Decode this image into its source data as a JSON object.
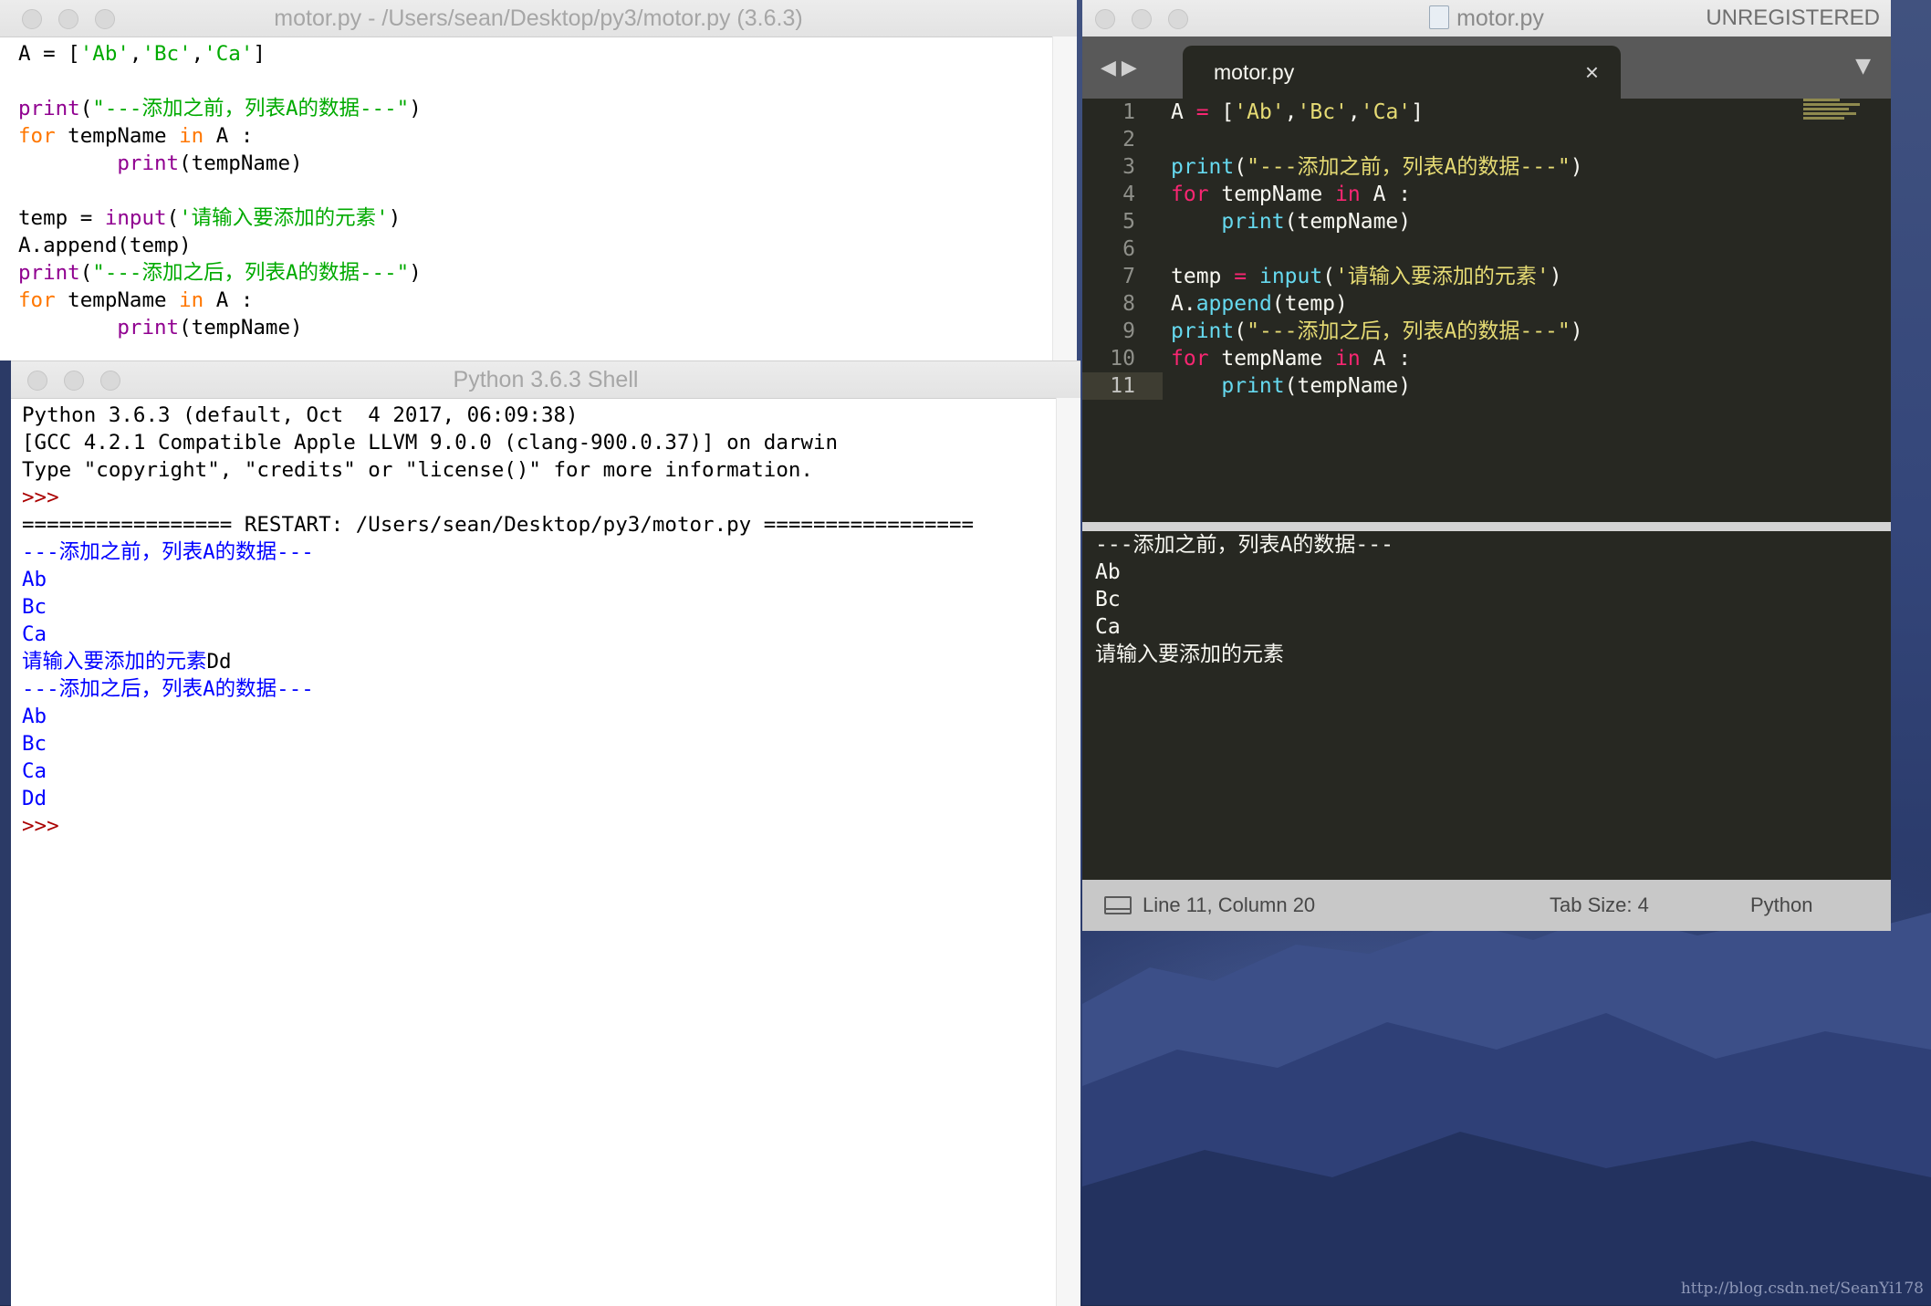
{
  "idle_editor": {
    "title": "motor.py - /Users/sean/Desktop/py3/motor.py (3.6.3)",
    "lines": [
      [
        {
          "t": "A = ['Ab','Bc','Ca']",
          "c": "st-mix"
        }
      ],
      [],
      [
        {
          "t": "print",
          "c": "bi"
        },
        {
          "t": "(",
          "c": ""
        },
        {
          "t": "\"---添加之前，列表A的数据---\"",
          "c": "st"
        },
        {
          "t": ")",
          "c": ""
        }
      ],
      [
        {
          "t": "for",
          "c": "kw"
        },
        {
          "t": " tempName ",
          "c": ""
        },
        {
          "t": "in",
          "c": "kw"
        },
        {
          "t": " A :",
          "c": ""
        }
      ],
      [
        {
          "t": "        ",
          "c": ""
        },
        {
          "t": "print",
          "c": "bi"
        },
        {
          "t": "(tempName)",
          "c": ""
        }
      ],
      [],
      [
        {
          "t": "temp = ",
          "c": ""
        },
        {
          "t": "input",
          "c": "bi"
        },
        {
          "t": "(",
          "c": ""
        },
        {
          "t": "'请输入要添加的元素'",
          "c": "st"
        },
        {
          "t": ")",
          "c": ""
        }
      ],
      [
        {
          "t": "A.append(temp)",
          "c": ""
        }
      ],
      [
        {
          "t": "print",
          "c": "bi"
        },
        {
          "t": "(",
          "c": ""
        },
        {
          "t": "\"---添加之后，列表A的数据---\"",
          "c": "st"
        },
        {
          "t": ")",
          "c": ""
        }
      ],
      [
        {
          "t": "for",
          "c": "kw"
        },
        {
          "t": " tempName ",
          "c": ""
        },
        {
          "t": "in",
          "c": "kw"
        },
        {
          "t": " A :",
          "c": ""
        }
      ],
      [
        {
          "t": "        ",
          "c": ""
        },
        {
          "t": "print",
          "c": "bi"
        },
        {
          "t": "(tempName)",
          "c": ""
        }
      ]
    ]
  },
  "shell": {
    "title": "Python 3.6.3 Shell",
    "lines": [
      [
        {
          "t": "Python 3.6.3 (default, Oct  4 2017, 06:09:38)",
          "c": ""
        }
      ],
      [
        {
          "t": "[GCC 4.2.1 Compatible Apple LLVM 9.0.0 (clang-900.0.37)] on darwin",
          "c": ""
        }
      ],
      [
        {
          "t": "Type \"copyright\", \"credits\" or \"license()\" for more information.",
          "c": ""
        }
      ],
      [
        {
          "t": ">>> ",
          "c": "prompt"
        }
      ],
      [
        {
          "t": "================= RESTART: /Users/sean/Desktop/py3/motor.py =================",
          "c": ""
        }
      ],
      [
        {
          "t": "---添加之前，列表A的数据---",
          "c": "out"
        }
      ],
      [
        {
          "t": "Ab",
          "c": "out"
        }
      ],
      [
        {
          "t": "Bc",
          "c": "out"
        }
      ],
      [
        {
          "t": "Ca",
          "c": "out"
        }
      ],
      [
        {
          "t": "请输入要添加的元素",
          "c": "out"
        },
        {
          "t": "Dd",
          "c": ""
        }
      ],
      [
        {
          "t": "---添加之后，列表A的数据---",
          "c": "out"
        }
      ],
      [
        {
          "t": "Ab",
          "c": "out"
        }
      ],
      [
        {
          "t": "Bc",
          "c": "out"
        }
      ],
      [
        {
          "t": "Ca",
          "c": "out"
        }
      ],
      [
        {
          "t": "Dd",
          "c": "out"
        }
      ],
      [
        {
          "t": ">>> ",
          "c": "prompt"
        }
      ]
    ]
  },
  "sublime": {
    "title": "motor.py",
    "unregistered": "UNREGISTERED",
    "tab_label": "motor.py",
    "tab_close": "×",
    "nav_arrows": "◀▶",
    "dropdown": "▼",
    "line_numbers": [
      "1",
      "2",
      "3",
      "4",
      "5",
      "6",
      "7",
      "8",
      "9",
      "10",
      "11"
    ],
    "active_line": 11,
    "lines": [
      [
        {
          "t": "A ",
          "c": ""
        },
        {
          "t": "=",
          "c": "m-kw"
        },
        {
          "t": " [",
          "c": ""
        },
        {
          "t": "'Ab'",
          "c": "m-str"
        },
        {
          "t": ",",
          "c": ""
        },
        {
          "t": "'Bc'",
          "c": "m-str"
        },
        {
          "t": ",",
          "c": ""
        },
        {
          "t": "'Ca'",
          "c": "m-str"
        },
        {
          "t": "]",
          "c": ""
        }
      ],
      [],
      [
        {
          "t": "print",
          "c": "m-fn"
        },
        {
          "t": "(",
          "c": ""
        },
        {
          "t": "\"---添加之前，列表A的数据---\"",
          "c": "m-str"
        },
        {
          "t": ")",
          "c": ""
        }
      ],
      [
        {
          "t": "for",
          "c": "m-kw"
        },
        {
          "t": " tempName ",
          "c": ""
        },
        {
          "t": "in",
          "c": "m-kw"
        },
        {
          "t": " A :",
          "c": ""
        }
      ],
      [
        {
          "t": "    ",
          "c": ""
        },
        {
          "t": "print",
          "c": "m-fn"
        },
        {
          "t": "(tempName)",
          "c": ""
        }
      ],
      [],
      [
        {
          "t": "temp ",
          "c": ""
        },
        {
          "t": "=",
          "c": "m-kw"
        },
        {
          "t": " ",
          "c": ""
        },
        {
          "t": "input",
          "c": "m-fn"
        },
        {
          "t": "(",
          "c": ""
        },
        {
          "t": "'请输入要添加的元素'",
          "c": "m-str"
        },
        {
          "t": ")",
          "c": ""
        }
      ],
      [
        {
          "t": "A.",
          "c": ""
        },
        {
          "t": "append",
          "c": "m-fn"
        },
        {
          "t": "(temp)",
          "c": ""
        }
      ],
      [
        {
          "t": "print",
          "c": "m-fn"
        },
        {
          "t": "(",
          "c": ""
        },
        {
          "t": "\"---添加之后，列表A的数据---\"",
          "c": "m-str"
        },
        {
          "t": ")",
          "c": ""
        }
      ],
      [
        {
          "t": "for",
          "c": "m-kw"
        },
        {
          "t": " tempName ",
          "c": ""
        },
        {
          "t": "in",
          "c": "m-kw"
        },
        {
          "t": " A :",
          "c": ""
        }
      ],
      [
        {
          "t": "    ",
          "c": ""
        },
        {
          "t": "print",
          "c": "m-fn"
        },
        {
          "t": "(tempName)",
          "c": ""
        }
      ]
    ],
    "console_lines": [
      "---添加之前，列表A的数据---",
      "Ab",
      "Bc",
      "Ca",
      "请输入要添加的元素"
    ],
    "status": {
      "position": "Line 11, Column 20",
      "tab_size": "Tab Size: 4",
      "syntax": "Python"
    }
  },
  "watermark": "http://blog.csdn.net/SeanYi178",
  "colors": {
    "idle_keyword": "#ff7700",
    "idle_builtin": "#900090",
    "idle_string": "#00aa00",
    "idle_output": "#0000ff",
    "monokai_bg": "#272822",
    "monokai_keyword": "#f92672",
    "monokai_function": "#66d9ef",
    "monokai_string": "#e6db74"
  }
}
